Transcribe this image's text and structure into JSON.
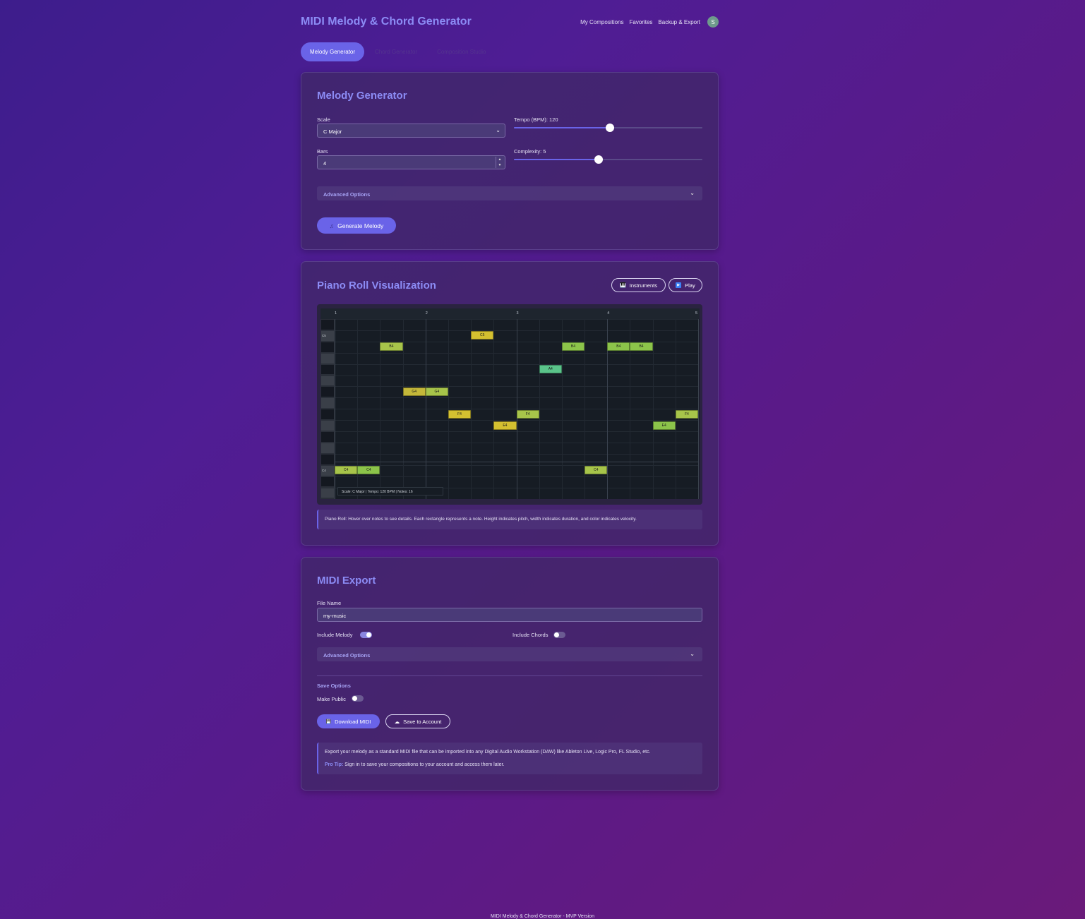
{
  "app": {
    "title": "MIDI Melody & Chord Generator",
    "nav": [
      "My Compositions",
      "Favorites",
      "Backup & Export"
    ],
    "avatar_initial": "S"
  },
  "tabs": [
    {
      "label": "Melody Generator",
      "active": true
    },
    {
      "label": "Chord Generator",
      "active": false
    },
    {
      "label": "Composition Studio",
      "active": false
    }
  ],
  "melody": {
    "title": "Melody Generator",
    "scale_label": "Scale",
    "scale_value": "C Major",
    "tempo_label": "Tempo (BPM): 120",
    "tempo_fraction": 0.51,
    "bars_label": "Bars",
    "bars_value": "4",
    "complexity_label": "Complexity: 5",
    "complexity_fraction": 0.45,
    "advanced_label": "Advanced Options",
    "generate_label": "Generate Melody",
    "generate_icon": "♫"
  },
  "piano_roll": {
    "title": "Piano Roll Visualization",
    "instruments_label": "Instruments",
    "instruments_icon": "🎹",
    "play_label": "Play",
    "play_icon": "▶",
    "bar_numbers": [
      "1",
      "2",
      "3",
      "4",
      "5"
    ],
    "key_labels": [
      "C5",
      "C4"
    ],
    "status": "Scale: C Major | Tempo: 120 BPM | Notes: 16",
    "hint": "Piano Roll: Hover over notes to see details. Each rectangle represents a note. Height indicates pitch, width indicates duration, and color indicates velocity.",
    "notes": [
      {
        "label": "C4",
        "pitch": "C4",
        "start": 0,
        "dur": 0.25,
        "color": "#a7c44a"
      },
      {
        "label": "C4",
        "pitch": "C4",
        "start": 0.25,
        "dur": 0.25,
        "color": "#8cc44a"
      },
      {
        "label": "B4",
        "pitch": "B4",
        "start": 0.5,
        "dur": 0.25,
        "color": "#a7c44a"
      },
      {
        "label": "G4",
        "pitch": "G4",
        "start": 0.75,
        "dur": 0.25,
        "color": "#c4b83a"
      },
      {
        "label": "G4",
        "pitch": "G4",
        "start": 1.0,
        "dur": 0.25,
        "color": "#a7c44a"
      },
      {
        "label": "F4",
        "pitch": "F4",
        "start": 1.25,
        "dur": 0.25,
        "color": "#d4c030"
      },
      {
        "label": "C5",
        "pitch": "C5",
        "start": 1.5,
        "dur": 0.25,
        "color": "#d4c030"
      },
      {
        "label": "E4",
        "pitch": "E4",
        "start": 1.75,
        "dur": 0.25,
        "color": "#d4c030"
      },
      {
        "label": "F4",
        "pitch": "F4",
        "start": 2.0,
        "dur": 0.25,
        "color": "#a7c44a"
      },
      {
        "label": "A4",
        "pitch": "A4",
        "start": 2.25,
        "dur": 0.25,
        "color": "#5ac48a"
      },
      {
        "label": "B4",
        "pitch": "B4",
        "start": 2.5,
        "dur": 0.25,
        "color": "#8cc44a"
      },
      {
        "label": "C4",
        "pitch": "C4",
        "start": 2.75,
        "dur": 0.25,
        "color": "#a7c44a"
      },
      {
        "label": "B4",
        "pitch": "B4",
        "start": 3.0,
        "dur": 0.25,
        "color": "#8cc44a"
      },
      {
        "label": "B4",
        "pitch": "B4",
        "start": 3.25,
        "dur": 0.25,
        "color": "#8cc44a"
      },
      {
        "label": "E4",
        "pitch": "E4",
        "start": 3.5,
        "dur": 0.25,
        "color": "#8cc44a"
      },
      {
        "label": "F4",
        "pitch": "F4",
        "start": 3.75,
        "dur": 0.25,
        "color": "#a7c44a"
      }
    ]
  },
  "export": {
    "title": "MIDI Export",
    "file_name_label": "File Name",
    "file_name_value": "my-music",
    "include_melody_label": "Include Melody",
    "include_melody": true,
    "include_chords_label": "Include Chords",
    "include_chords": false,
    "advanced_label": "Advanced Options",
    "save_options_label": "Save Options",
    "make_public_label": "Make Public",
    "make_public": false,
    "download_label": "Download MIDI",
    "download_icon": "💾",
    "save_account_label": "Save to Account",
    "save_account_icon": "☁",
    "info_text": "Export your melody as a standard MIDI file that can be imported into any Digital Audio Workstation (DAW) like Ableton Live, Logic Pro, FL Studio, etc.",
    "tip_label": "Pro Tip:",
    "tip_text": "Sign in to save your compositions to your account and access them later."
  },
  "footer": "MIDI Melody & Chord Generator - MVP Version",
  "colors": {
    "accent": "#6a63e8",
    "title": "#8c8cf5"
  }
}
